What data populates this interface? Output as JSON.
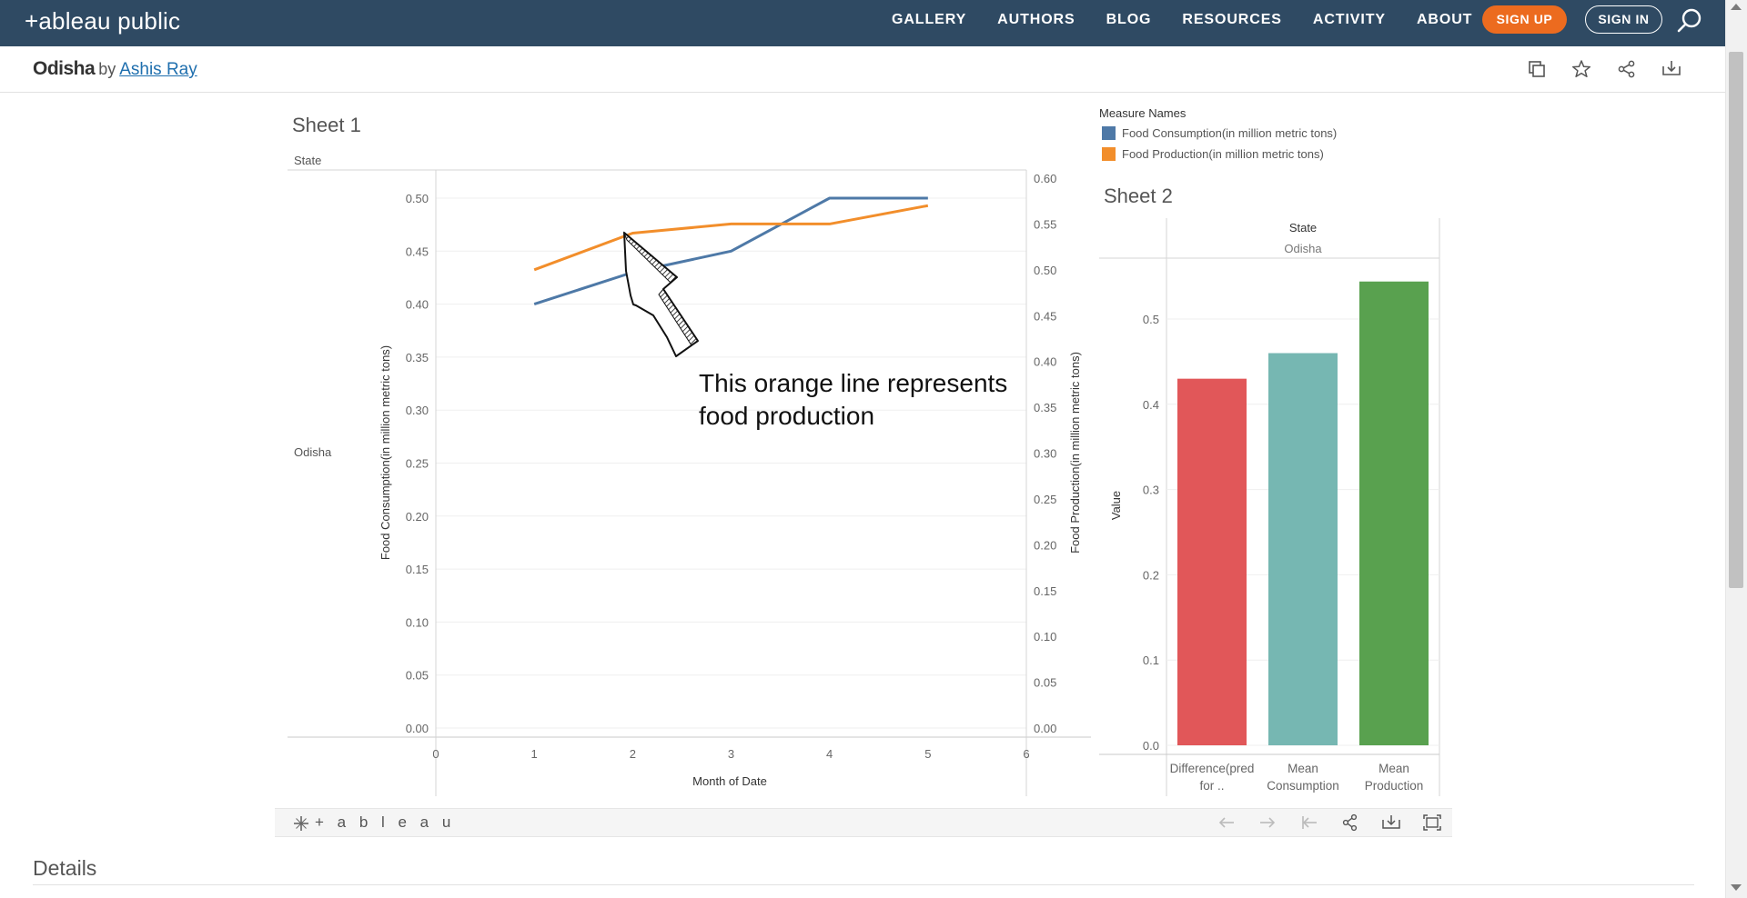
{
  "nav": {
    "logo": "+ableau public",
    "links": [
      "GALLERY",
      "AUTHORS",
      "BLOG",
      "RESOURCES",
      "ACTIVITY",
      "ABOUT"
    ],
    "signup": "SIGN UP",
    "signin": "SIGN IN",
    "icons": [
      "search-icon"
    ]
  },
  "header": {
    "title": "Odisha",
    "by": "by",
    "author": "Ashis Ray",
    "icons": [
      "copy-icon",
      "star-icon",
      "share-icon",
      "download-icon"
    ]
  },
  "sheet1": {
    "title": "Sheet 1",
    "row_header": "State",
    "row_value": "Odisha"
  },
  "legend": {
    "title": "Measure Names",
    "items": [
      {
        "label": "Food Consumption(in million metric tons)",
        "color": "#4e79a7"
      },
      {
        "label": "Food Production(in million metric tons)",
        "color": "#f28e2b"
      }
    ]
  },
  "annotation": {
    "line1": "This orange line represents",
    "line2": "food production"
  },
  "chart_data": [
    {
      "type": "line",
      "title": "Sheet 1",
      "xlabel": "Month of Date",
      "ylabel": "Food Consumption(in million metric tons)",
      "y2label": "Food Production(in million metric tons)",
      "x": [
        1,
        2,
        3,
        4,
        5
      ],
      "xlim": [
        0,
        6
      ],
      "x_ticks": [
        "0",
        "1",
        "2",
        "3",
        "4",
        "5",
        "6"
      ],
      "ylim": [
        0,
        0.5
      ],
      "y_ticks": [
        "0.00",
        "0.05",
        "0.10",
        "0.15",
        "0.20",
        "0.25",
        "0.30",
        "0.35",
        "0.40",
        "0.45",
        "0.50"
      ],
      "y2lim": [
        0,
        0.6
      ],
      "y2_ticks": [
        "0.00",
        "0.05",
        "0.10",
        "0.15",
        "0.20",
        "0.25",
        "0.30",
        "0.35",
        "0.40",
        "0.45",
        "0.50",
        "0.55",
        "0.60"
      ],
      "series": [
        {
          "name": "Food Consumption(in million metric tons)",
          "axis": "left",
          "color": "#4e79a7",
          "values": [
            0.4,
            0.43,
            0.45,
            0.5,
            0.5
          ]
        },
        {
          "name": "Food Production(in million metric tons)",
          "axis": "right",
          "color": "#f28e2b",
          "values": [
            0.5,
            0.54,
            0.55,
            0.55,
            0.57
          ]
        }
      ],
      "grid": true
    },
    {
      "type": "bar",
      "title": "Sheet 2",
      "column_header": "State",
      "column_value": "Odisha",
      "ylabel": "Value",
      "categories": [
        "Difference(pred for ..",
        "Mean Consumption",
        "Mean Production"
      ],
      "category_lines": [
        [
          "Difference(pred",
          "for .."
        ],
        [
          "Mean",
          "Consumption"
        ],
        [
          "Mean",
          "Production"
        ]
      ],
      "values": [
        0.43,
        0.46,
        0.544
      ],
      "colors": [
        "#e15759",
        "#76b7b2",
        "#59a14f"
      ],
      "ylim": [
        0,
        0.5
      ],
      "y_ticks": [
        "0.0",
        "0.1",
        "0.2",
        "0.3",
        "0.4",
        "0.5"
      ],
      "grid": true
    }
  ],
  "sheet2": {
    "title": "Sheet 2"
  },
  "toolbar": {
    "logo": "+ a b l e a u",
    "icons": [
      "undo-icon",
      "redo-icon",
      "revert-icon",
      "share-icon",
      "download-icon",
      "fullscreen-icon"
    ]
  },
  "details": {
    "title": "Details"
  }
}
